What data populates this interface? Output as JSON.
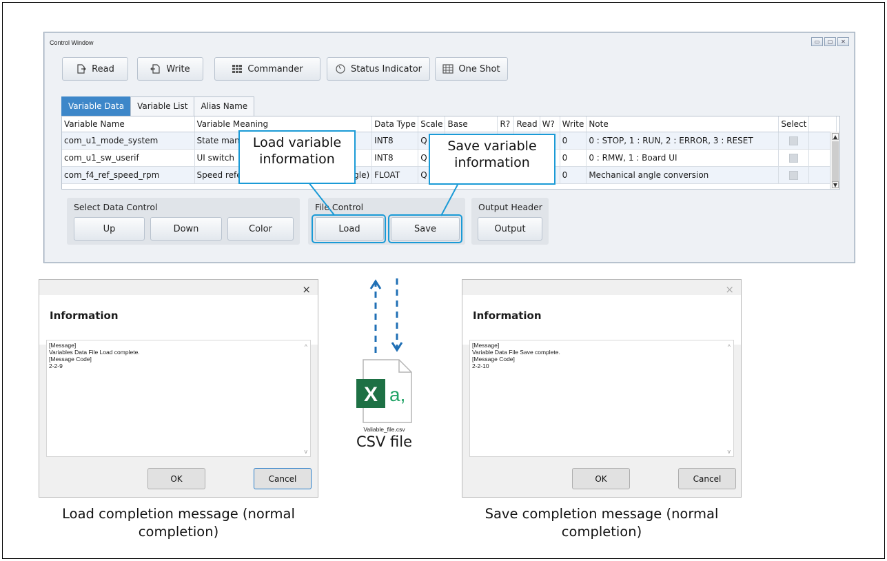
{
  "control_window": {
    "title": "Control Window",
    "window_buttons": [
      "▭",
      "▢",
      "✕"
    ],
    "toolbar": [
      {
        "label": "Read",
        "icon": "read-icon"
      },
      {
        "label": "Write",
        "icon": "write-icon"
      },
      {
        "label": "Commander",
        "icon": "grid-icon"
      },
      {
        "label": "Status Indicator",
        "icon": "gauge-icon"
      },
      {
        "label": "One Shot",
        "icon": "table-icon"
      }
    ],
    "tabs": [
      "Variable Data",
      "Variable List",
      "Alias Name"
    ],
    "columns": [
      "Variable Name",
      "Variable Meaning",
      "Data Type",
      "Scale",
      "Base",
      "R?",
      "Read",
      "W?",
      "Write",
      "Note",
      "Select"
    ],
    "rows": [
      {
        "name": "com_u1_mode_system",
        "meaning": "State man",
        "type": "INT8",
        "scale": "Q",
        "write": "0",
        "note": "0 : STOP, 1 : RUN, 2 : ERROR, 3 : RESET"
      },
      {
        "name": "com_u1_sw_userif",
        "meaning": "UI switch",
        "type": "INT8",
        "scale": "Q",
        "write": "0",
        "note": "0 : RMW, 1 : Board UI"
      },
      {
        "name": "com_f4_ref_speed_rpm",
        "meaning": "Speed reference value(mechanical angle)",
        "type": "FLOAT",
        "scale": "Q",
        "write": "0",
        "note": "Mechanical angle conversion"
      }
    ],
    "groups": {
      "select": {
        "label": "Select Data Control",
        "buttons": [
          "Up",
          "Down",
          "Color"
        ]
      },
      "file": {
        "label": "File Control",
        "buttons": [
          "Load",
          "Save"
        ]
      },
      "output": {
        "label": "Output Header",
        "buttons": [
          "Output"
        ]
      }
    },
    "callouts": {
      "load": "Load variable information",
      "save": "Save variable information"
    }
  },
  "load_dialog": {
    "close": "×",
    "heading": "Information",
    "message_lines": [
      "[Message]",
      " Variables Data File Load complete.",
      "[Message Code]",
      " 2-2-9"
    ],
    "ok": "OK",
    "cancel": "Cancel",
    "caption": "Load completion message (normal completion)"
  },
  "save_dialog": {
    "close": "×",
    "heading": "Information",
    "message_lines": [
      "[Message]",
      " Variable Data File Save complete.",
      "[Message Code]",
      " 2-2-10"
    ],
    "ok": "OK",
    "cancel": "Cancel",
    "caption": "Save completion message (normal completion)"
  },
  "csv": {
    "filename": "Valiable_file.csv",
    "label": "CSV file",
    "icon_letter": "X",
    "icon_text": "a,"
  },
  "colors": {
    "accent": "#1a9ad6",
    "tab_active": "#3d87c9",
    "excel_green": "#1d7044"
  }
}
